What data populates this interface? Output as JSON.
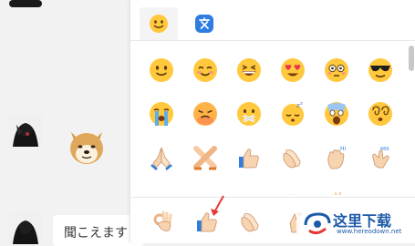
{
  "chat": {
    "message_partial": "聞こえます"
  },
  "tabs": [
    {
      "name": "emoji-tab",
      "icon": "smiley-face-icon",
      "active": true
    },
    {
      "name": "translate-tab",
      "icon": "translate-icon",
      "active": false
    }
  ],
  "emoji_rows": [
    [
      "slightly-smiling-face",
      "smiling-face-with-blush",
      "grinning-squinting-face",
      "heart-eyes-face",
      "flushed-face",
      "sunglasses-face"
    ],
    [
      "loudly-crying-face",
      "pouting-face",
      "zipper-mouth-face",
      "sleeping-face",
      "screaming-face",
      "dizzy-face"
    ],
    [
      "folded-hands",
      "crossed-arms",
      "thumbs-up",
      "clapping-hands",
      "waving-hand-hi",
      "waving-hand-666"
    ],
    [
      "hand-partial-1",
      "hand-partial-2",
      "hand-partial-3",
      "hand-partial-4",
      "hand-partial-5",
      "hand-partial-6"
    ]
  ],
  "bottom_row": [
    "ok-hand",
    "thumbs-up-selected",
    "clapping-hands",
    "finger-heart"
  ],
  "watermark": {
    "text": "这里下载",
    "url": "www.hereodown.net"
  },
  "colors": {
    "emoji_yellow": "#ffc83d",
    "emoji_orange": "#f59e1b",
    "skin": "#f8d3b0",
    "accent_blue": "#2f7de1",
    "arrow_red": "#e53935"
  }
}
